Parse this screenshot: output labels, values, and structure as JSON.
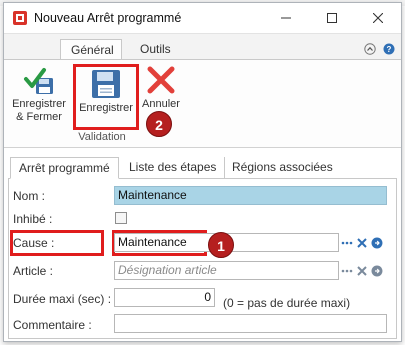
{
  "window": {
    "title": "Nouveau Arrêt programmé",
    "controls": {
      "minimize": "minimize-icon",
      "maximize": "maximize-icon",
      "close": "close-icon"
    }
  },
  "ribbon": {
    "tabs": [
      {
        "label": "Général",
        "active": true
      },
      {
        "label": "Outils",
        "active": false
      }
    ],
    "buttons": {
      "save_close": {
        "label_line1": "Enregistrer",
        "label_line2": "& Fermer",
        "icon": "save-close-icon"
      },
      "save": {
        "label": "Enregistrer",
        "icon": "floppy-disk-icon"
      },
      "cancel": {
        "label": "Annuler",
        "icon": "red-x-icon"
      }
    },
    "group_label": "Validation"
  },
  "content_tabs": [
    {
      "label": "Arrêt programmé",
      "active": true
    },
    {
      "label": "Liste des étapes",
      "active": false
    },
    {
      "label": "Régions associées",
      "active": false
    }
  ],
  "form": {
    "nom": {
      "label": "Nom :",
      "value": "Maintenance"
    },
    "inhibe": {
      "label": "Inhibé :",
      "checked": false
    },
    "cause": {
      "label": "Cause :",
      "value": "Maintenance"
    },
    "article": {
      "label": "Article :",
      "placeholder": "Désignation article"
    },
    "duree": {
      "label": "Durée maxi (sec) :",
      "value": "0",
      "hint": "(0 = pas de durée maxi)"
    },
    "commentaire": {
      "label": "Commentaire :",
      "value": ""
    }
  },
  "annotations": {
    "badge_1": "1",
    "badge_2": "2"
  },
  "colors": {
    "highlight_red": "#e01d1d",
    "badge_red": "#b51f1f",
    "field_highlight": "#a9d4e6",
    "action_blue": "#2f6fb5"
  }
}
